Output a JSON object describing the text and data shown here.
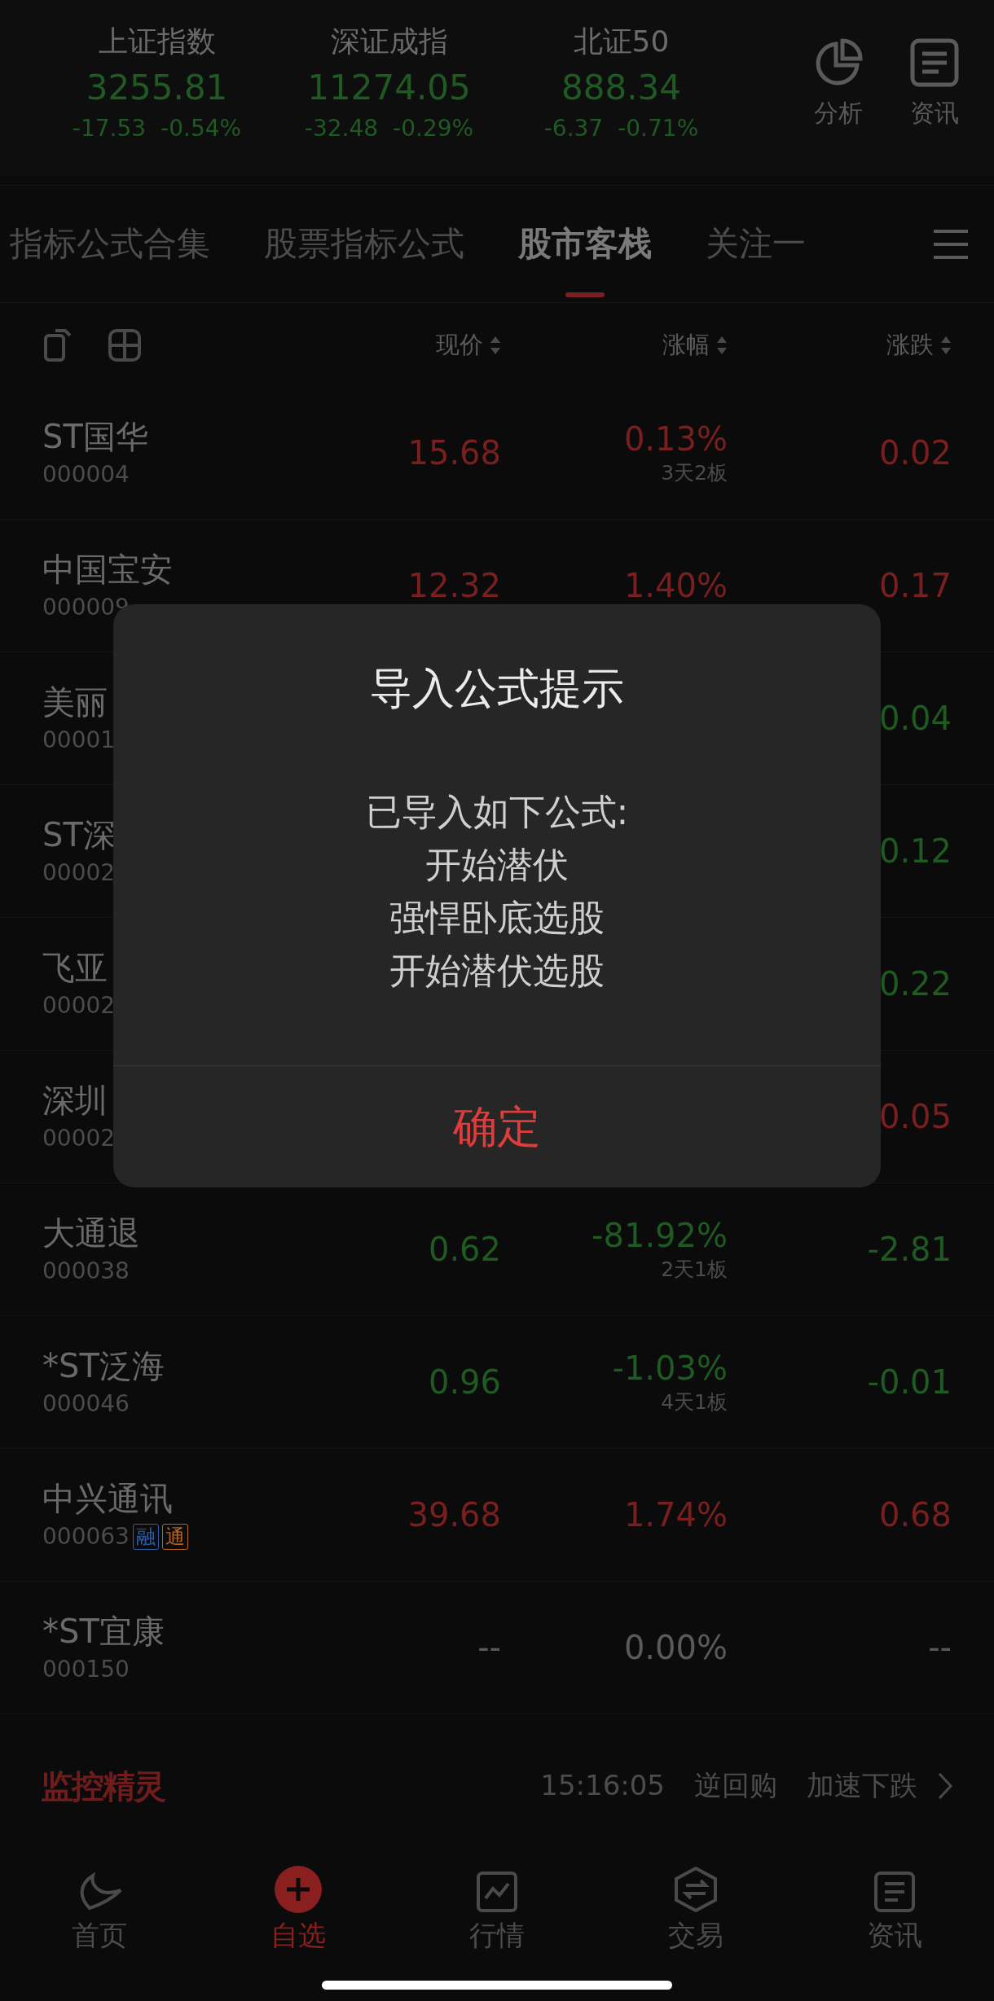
{
  "indices": [
    {
      "name": "上证指数",
      "value": "3255.81",
      "change": "-17.53",
      "percent": "-0.54%",
      "color": "#1f5a22"
    },
    {
      "name": "深证成指",
      "value": "11274.05",
      "change": "-32.48",
      "percent": "-0.29%",
      "color": "#1f5a22"
    },
    {
      "name": "北证50",
      "value": "888.34",
      "change": "-6.37",
      "percent": "-0.71%",
      "color": "#1f5a22"
    }
  ],
  "header_actions": [
    {
      "label": "分析"
    },
    {
      "label": "资讯"
    }
  ],
  "tabs": [
    {
      "label": "指标公式合集",
      "selected": false
    },
    {
      "label": "股票指标公式",
      "selected": false
    },
    {
      "label": "股市客栈",
      "selected": true
    },
    {
      "label": "关注一",
      "selected": false
    }
  ],
  "columns": [
    {
      "label": "现价"
    },
    {
      "label": "涨幅"
    },
    {
      "label": "涨跌"
    }
  ],
  "rows": [
    {
      "name": "ST国华",
      "code": "000004",
      "price": "15.68",
      "percent": "0.13%",
      "sub": "3天2板",
      "change": "0.02",
      "color": "#7a1f1f",
      "tags": []
    },
    {
      "name": "中国宝安",
      "code": "000009",
      "price": "12.32",
      "percent": "1.40%",
      "change": "0.17",
      "color": "#7a1f1f",
      "tags": []
    },
    {
      "name": "美丽",
      "code": "00001",
      "change": "0.04",
      "color": "#1f5a22",
      "tags": []
    },
    {
      "name": "ST深",
      "code": "00002",
      "change": "0.12",
      "color": "#1f5a22",
      "tags": []
    },
    {
      "name": "飞亚",
      "code": "00002",
      "change": "0.22",
      "color": "#1f5a22",
      "tags": []
    },
    {
      "name": "深圳",
      "code": "00002",
      "change": "0.05",
      "color": "#7a1f1f",
      "tags": []
    },
    {
      "name": "大通退",
      "code": "000038",
      "price": "0.62",
      "percent": "-81.92%",
      "sub": "2天1板",
      "change": "-2.81",
      "color": "#1f5a22",
      "tags": []
    },
    {
      "name": "*ST泛海",
      "code": "000046",
      "price": "0.96",
      "percent": "-1.03%",
      "sub": "4天1板",
      "change": "-0.01",
      "color": "#1f5a22",
      "tags": []
    },
    {
      "name": "中兴通讯",
      "code": "000063",
      "price": "39.68",
      "percent": "1.74%",
      "change": "0.68",
      "color": "#7a1f1f",
      "tags": [
        {
          "label": "融",
          "color": "#2f5fa8"
        },
        {
          "label": "通",
          "color": "#b8651f"
        }
      ]
    },
    {
      "name": "*ST宜康",
      "code": "000150",
      "price": "--",
      "percent": "0.00%",
      "change": "--",
      "color": "#5a5a5a",
      "tags": []
    }
  ],
  "monitor": {
    "brand": "监控精灵",
    "time": "15:16:05",
    "event_1": "逆回购",
    "event_2": "加速下跌"
  },
  "nav": [
    {
      "label": "首页",
      "selected": false
    },
    {
      "label": "自选",
      "selected": true
    },
    {
      "label": "行情",
      "selected": false
    },
    {
      "label": "交易",
      "selected": false
    },
    {
      "label": "资讯",
      "selected": false
    }
  ],
  "dialog": {
    "title": "导入公式提示",
    "lines": [
      "已导入如下公式:",
      "开始潜伏",
      "强悍卧底选股",
      "开始潜伏选股"
    ],
    "confirm": "确定"
  }
}
